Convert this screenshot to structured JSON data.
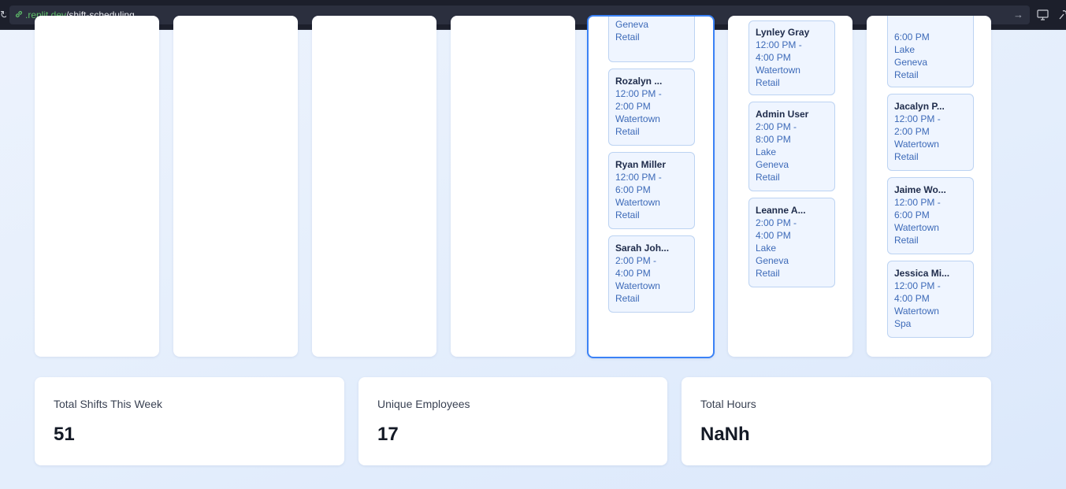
{
  "browser": {
    "url_domain": ".replit.dev",
    "url_path": "/shift-scheduling"
  },
  "columns": [
    {
      "id": "col-1",
      "cards": []
    },
    {
      "id": "col-2",
      "cards": []
    },
    {
      "id": "col-3",
      "cards": []
    },
    {
      "id": "col-4",
      "cards": []
    },
    {
      "id": "col-5-today",
      "cards": [
        {
          "name": "",
          "lines": [
            "Geneva",
            "Retail"
          ]
        },
        {
          "name": "Rozalyn ...",
          "lines": [
            "12:00 PM -",
            "2:00 PM",
            "Watertown",
            "Retail"
          ]
        },
        {
          "name": "Ryan Miller",
          "lines": [
            "12:00 PM -",
            "6:00 PM",
            "Watertown",
            "Retail"
          ]
        },
        {
          "name": "Sarah Joh...",
          "lines": [
            "2:00 PM -",
            "4:00 PM",
            "Watertown",
            "Retail"
          ]
        }
      ]
    },
    {
      "id": "col-6",
      "cards": [
        {
          "name": "Lynley Gray",
          "lines": [
            "12:00 PM -",
            "4:00 PM",
            "Watertown",
            "Retail"
          ]
        },
        {
          "name": "Admin User",
          "lines": [
            "2:00 PM -",
            "8:00 PM",
            "Lake",
            "Geneva",
            "Retail"
          ]
        },
        {
          "name": "Leanne A...",
          "lines": [
            "2:00 PM -",
            "4:00 PM",
            "Lake",
            "Geneva",
            "Retail"
          ]
        }
      ]
    },
    {
      "id": "col-7",
      "cards": [
        {
          "name": "",
          "lines": [
            "6:00 PM",
            "Lake",
            "Geneva",
            "Retail"
          ]
        },
        {
          "name": "Jacalyn P...",
          "lines": [
            "12:00 PM -",
            "2:00 PM",
            "Watertown",
            "Retail"
          ]
        },
        {
          "name": "Jaime Wo...",
          "lines": [
            "12:00 PM -",
            "6:00 PM",
            "Watertown",
            "Retail"
          ]
        },
        {
          "name": "Jessica Mi...",
          "lines": [
            "12:00 PM -",
            "4:00 PM",
            "Watertown",
            "Spa"
          ]
        }
      ]
    }
  ],
  "stats": {
    "total_shifts_label": "Total Shifts This Week",
    "total_shifts_value": "51",
    "unique_employees_label": "Unique Employees",
    "unique_employees_value": "17",
    "total_hours_label": "Total Hours",
    "total_hours_value": "NaNh"
  },
  "colors": {
    "accent": "#3b82f6",
    "card_bg": "#eff5ff",
    "card_border": "#bcd3f2",
    "card_text": "#3d6ab8"
  }
}
